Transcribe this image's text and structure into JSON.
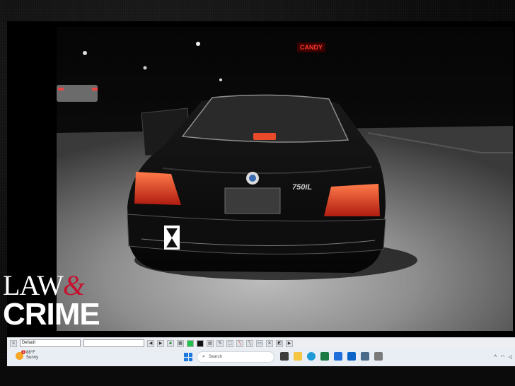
{
  "overlay": {
    "brand_line1": "LAW",
    "brand_amp": "&",
    "brand_line2": "CRIME"
  },
  "photo": {
    "sign_text": "CANDY",
    "car_badge": "750iL"
  },
  "viewer_toolbar": {
    "profile_select": "Default",
    "second_select": ""
  },
  "taskbar": {
    "weather_temp": "88°F",
    "weather_condition": "Sunny",
    "weather_badge": "1",
    "search_placeholder": "Search"
  },
  "colors": {
    "accent_red": "#c8102e",
    "taskbar_bg": "#e9eef5",
    "windows_blue": "#1f7ae0"
  }
}
